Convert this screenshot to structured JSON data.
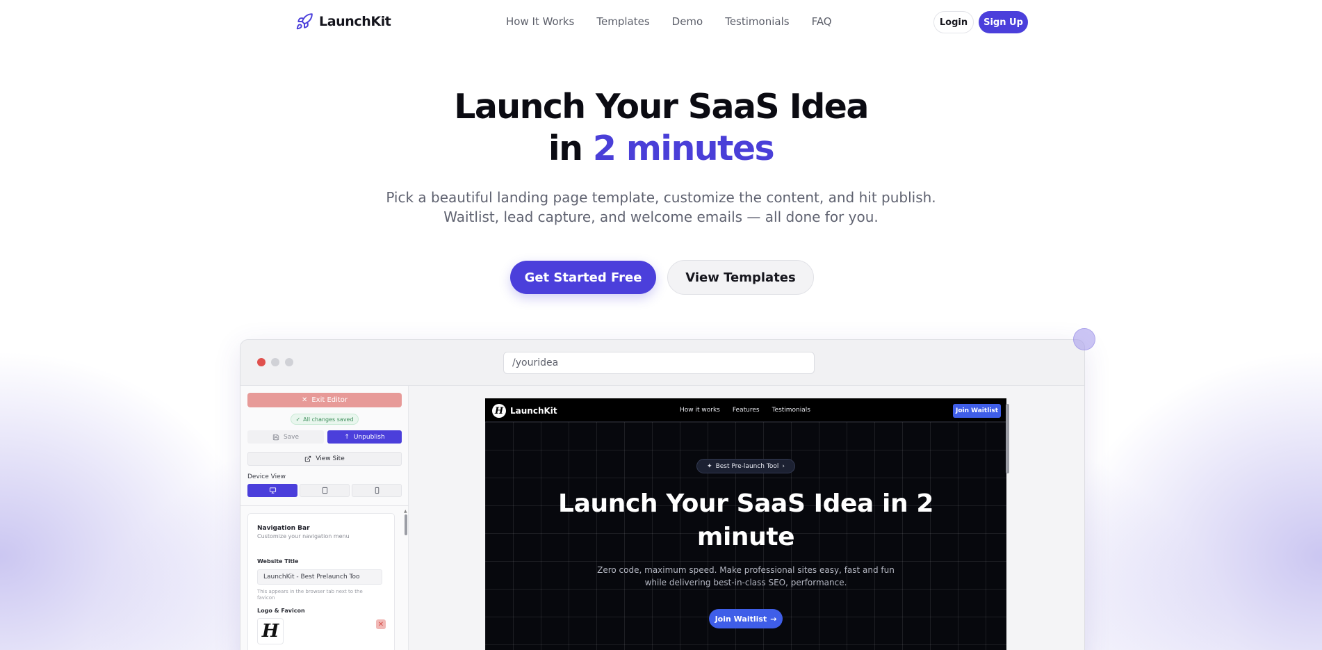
{
  "brand": {
    "name": "LaunchKit",
    "accent": "#4b3fdb"
  },
  "nav": {
    "links": [
      "How It Works",
      "Templates",
      "Demo",
      "Testimonials",
      "FAQ"
    ],
    "login": "Login",
    "signup": "Sign Up"
  },
  "hero": {
    "title_line1": "Launch Your SaaS Idea",
    "title_line2_prefix": "in ",
    "title_line2_accent": "2 minutes",
    "subtitle_line1": "Pick a beautiful landing page template, customize the content, and hit publish.",
    "subtitle_line2": "Waitlist, lead capture, and welcome emails — all done for you.",
    "cta_primary": "Get Started Free",
    "cta_secondary": "View Templates"
  },
  "browser": {
    "url": "/youridea",
    "dot_colors": [
      "#e0504d",
      "#d0d1d6",
      "#d0d1d6"
    ]
  },
  "editor": {
    "exit_label": "Exit Editor",
    "saved_label": "All changes saved",
    "save_label": "Save",
    "unpublish_label": "Unpublish",
    "view_site_label": "View Site",
    "device_view_label": "Device View",
    "devices": [
      "desktop",
      "tablet",
      "mobile"
    ],
    "active_device": "desktop",
    "panel": {
      "title": "Navigation Bar",
      "subtitle": "Customize your navigation menu",
      "website_title_label": "Website Title",
      "website_title_value": "LaunchKit - Best Prelaunch Too",
      "website_title_help": "This appears in the browser tab next to the favicon",
      "logo_label": "Logo & Favicon",
      "logo_glyph": "H"
    }
  },
  "preview": {
    "logo_glyph": "H",
    "logo_text": "LaunchKit",
    "links": [
      "How it works",
      "Features",
      "Testimonials"
    ],
    "nav_cta": "Join Waitlist",
    "badge": "Best Pre-launch Tool",
    "headline_line1": "Launch Your SaaS Idea in 2",
    "headline_line2": "minute",
    "desc_line1": "Zero code, maximum speed. Make professional sites easy, fast and fun",
    "desc_line2": "while delivering best-in-class SEO, performance.",
    "cta": "Join Waitlist",
    "accent": "#3f5ee8"
  }
}
